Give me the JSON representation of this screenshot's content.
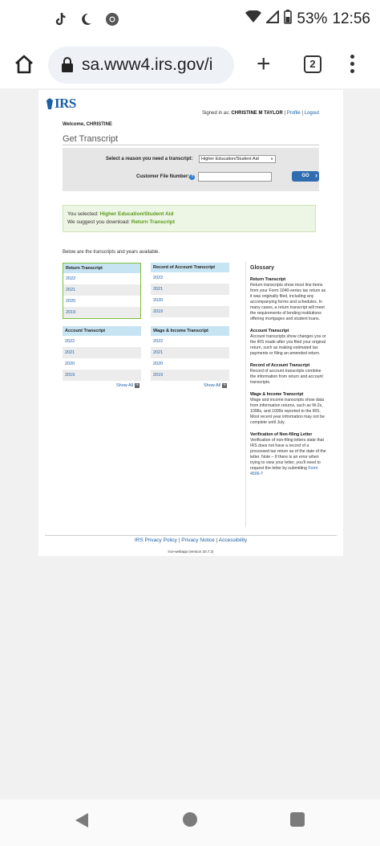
{
  "status_bar": {
    "battery": "53%",
    "time": "12:56"
  },
  "browser": {
    "url": "sa.www4.irs.gov/i",
    "tab_count": "2"
  },
  "header": {
    "logo": "IRS",
    "signed_in_prefix": "Signed in as:",
    "user_name": "CHRISTINE M TAYLOR",
    "sep": "|",
    "profile": "Profile",
    "logout": "Logout",
    "welcome": "Welcome, CHRISTINE"
  },
  "form": {
    "title": "Get Transcript",
    "reason_label": "Select a reason you need a transcript:",
    "reason_value": "Higher Education/Student Aid",
    "cfn_label": "Customer File Number:",
    "help": "?",
    "go": "GO"
  },
  "selection": {
    "you_selected": "You selected:",
    "selected_value": "Higher Education/Student Aid",
    "suggest": "We suggest you download:",
    "suggest_value": "Return Transcript"
  },
  "transcripts": {
    "intro": "Below are the transcripts and years available.",
    "groups": [
      {
        "title": "Return Transcript",
        "years": [
          "2022",
          "2021",
          "2020",
          "2019"
        ]
      },
      {
        "title": "Record of Account Transcript",
        "years": [
          "2022",
          "2021",
          "2020",
          "2019"
        ]
      },
      {
        "title": "Account Transcript",
        "years": [
          "2022",
          "2021",
          "2020",
          "2019"
        ]
      },
      {
        "title": "Wage & Income Transcript",
        "years": [
          "2022",
          "2021",
          "2020",
          "2019"
        ]
      }
    ],
    "show_all": "Show All",
    "plus": "+"
  },
  "glossary": {
    "title": "Glossary",
    "entries": [
      {
        "term": "Return Transcript",
        "def": "Return transcripts show most line items from your Form 1040-series tax return as it was originally filed, including any accompanying forms and schedules. In many cases, a return transcript will meet the requirements of lending institutions offering mortgages and student loans."
      },
      {
        "term": "Account Transcript",
        "def": "Account transcripts show changes you or the IRS made after you filed your original return, such as making estimated tax payments or filing an amended return."
      },
      {
        "term": "Record of Account Transcript",
        "def": "Record of account transcripts combine the information from return and account transcripts."
      },
      {
        "term": "Wage & Income Transcript",
        "def": "Wage and income transcripts show data from information returns, such as W-2s, 1098s, and 1099s reported to the IRS. Most recent year information may not be complete until July."
      },
      {
        "term": "Verification of Non-filing Letter",
        "def": "Verification of non-filing letters state that IRS does not have a record of a processed tax return as of the date of the letter. Note – If there is an error when trying to view your letter, you'll need to request the letter by submitting",
        "link": "Form 4506-T"
      }
    ]
  },
  "footer": {
    "privacy": "IRS Privacy Policy",
    "notice": "Privacy Notice",
    "accessibility": "Accessibility",
    "sep": "|",
    "version": "irce-webapp (version 20.7.2)"
  }
}
